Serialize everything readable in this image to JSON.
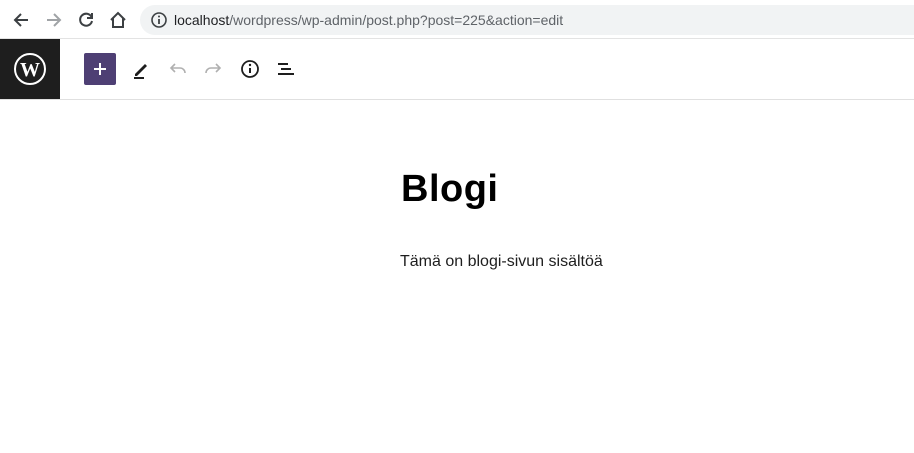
{
  "browser": {
    "url_host": "localhost",
    "url_path": "/wordpress/wp-admin/post.php?post=225&action=edit",
    "icons": [
      "back-arrow-icon",
      "forward-arrow-icon",
      "reload-icon",
      "home-icon",
      "info-icon"
    ]
  },
  "editor": {
    "toolbar": {
      "icons": [
        "wordpress-logo-icon",
        "plus-icon",
        "pencil-icon",
        "undo-icon",
        "redo-icon",
        "info-icon",
        "list-view-icon"
      ],
      "accent_color": "#4e3f74"
    },
    "post": {
      "title": "Blogi",
      "paragraph": "Tämä on blogi-sivun sisältöä"
    }
  }
}
